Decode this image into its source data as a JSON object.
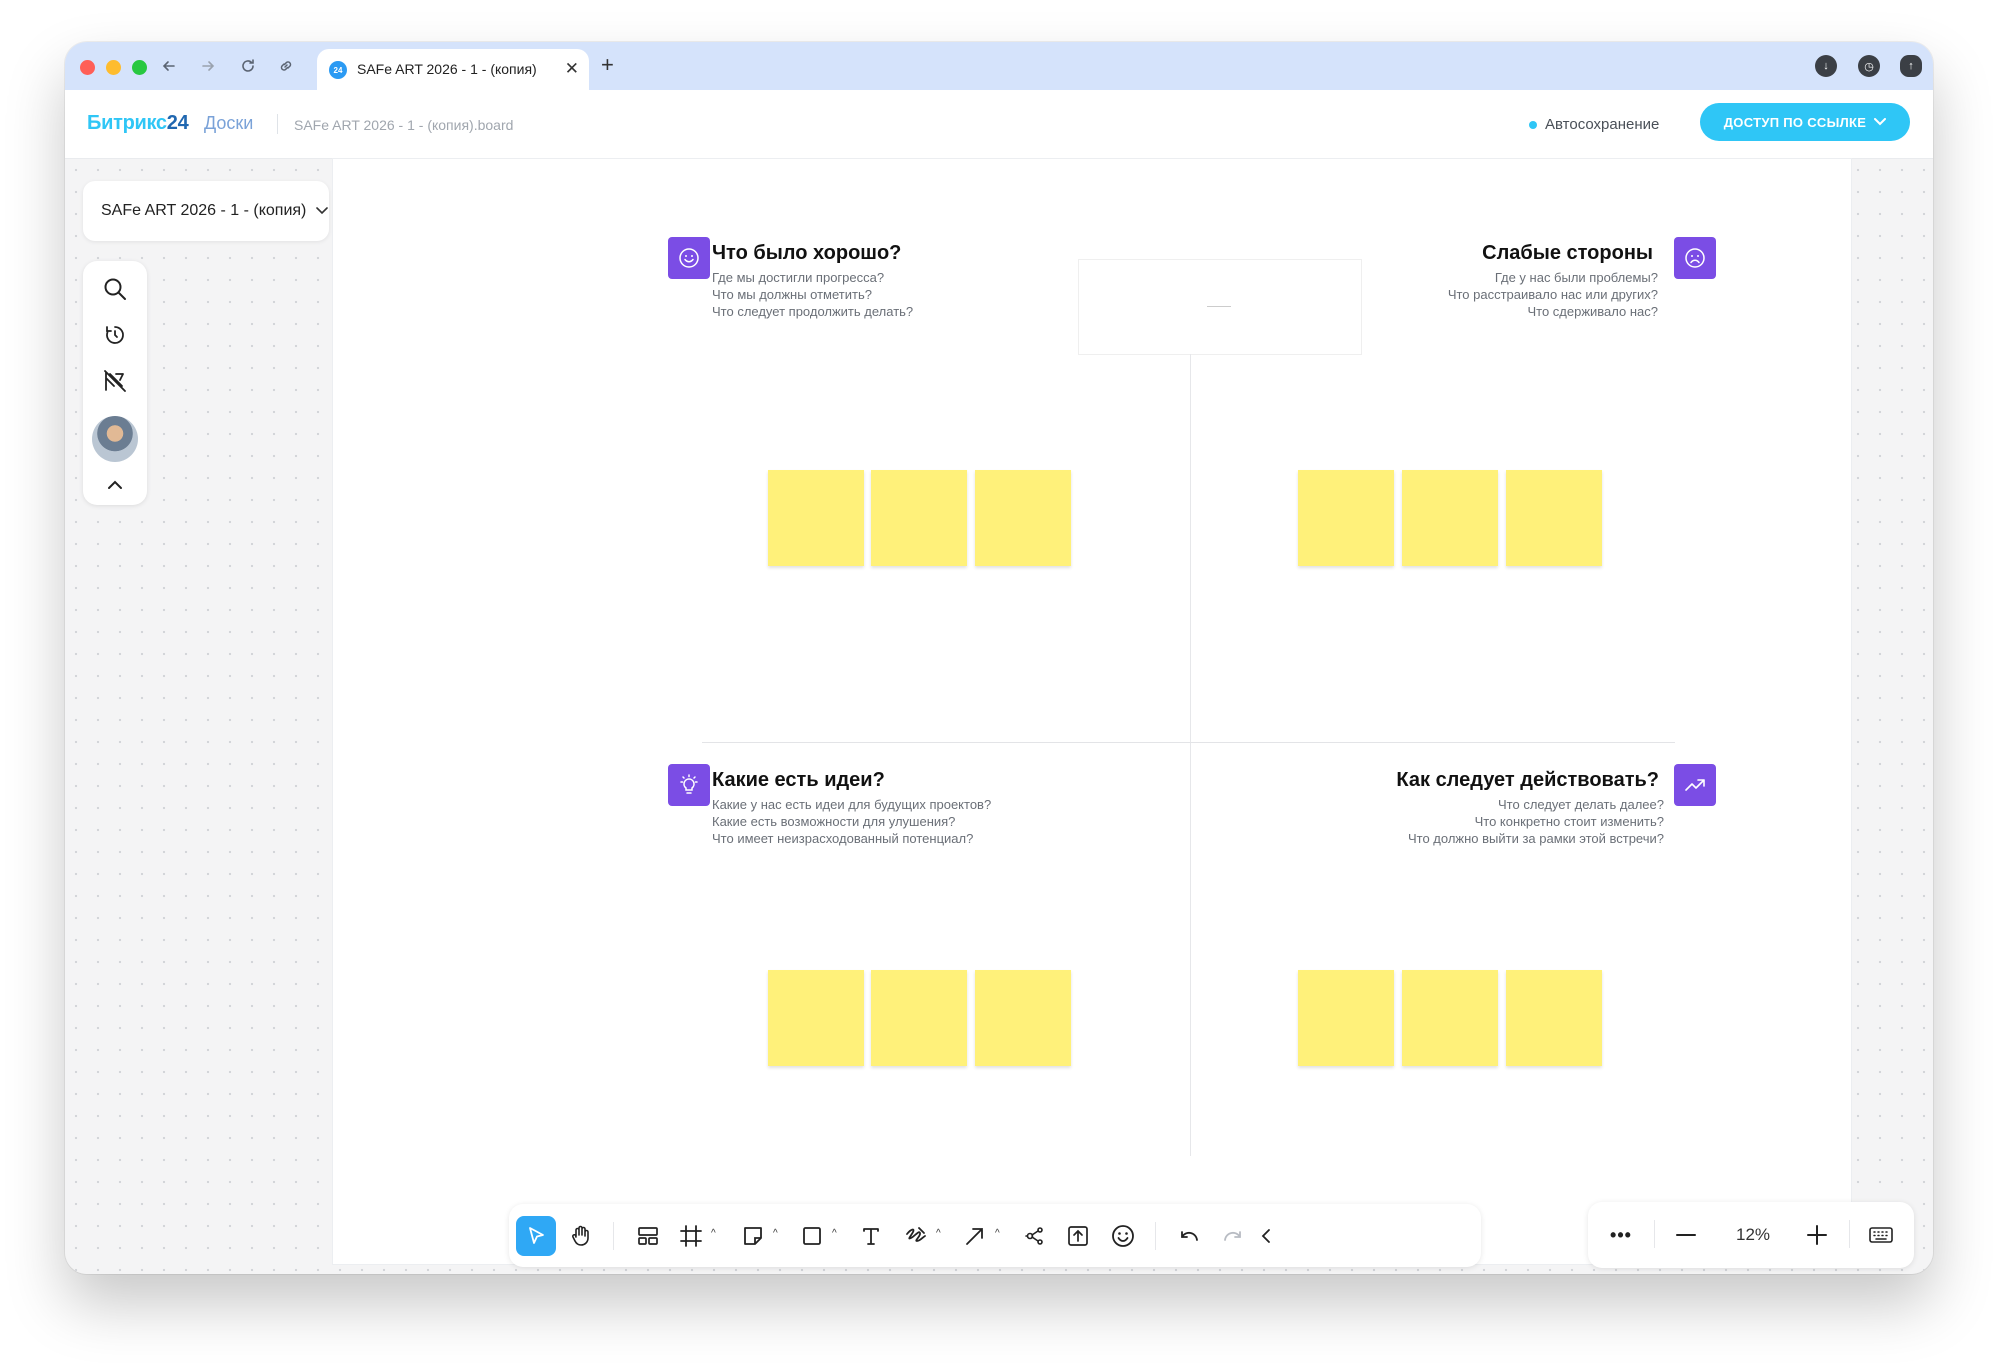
{
  "browser": {
    "tab_title": "SAFe ART 2026 - 1 - (копия)",
    "tab_favicon": "24",
    "new_tab": "+",
    "close_tab": "✕"
  },
  "header": {
    "logo_brand": "Битрикс",
    "logo_number": "24",
    "logo_product": "Доски",
    "file_name": "SAFe ART 2026 - 1 - (копия).board",
    "autosave": "Автосохранение",
    "access_button": "ДОСТУП ПО ССЫЛКЕ",
    "accent_color": "#2fc6f6"
  },
  "board": {
    "name": "SAFe ART 2026 - 1 - (копия)",
    "quadrants": [
      {
        "title": "Что было хорошо?",
        "icon": "smile-icon",
        "questions": [
          "Где мы достигли прогресса?",
          "Что мы должны отметить?",
          "Что следует продолжить делать?"
        ]
      },
      {
        "title": "Слабые стороны",
        "icon": "sad-face-icon",
        "questions": [
          "Где у нас были проблемы?",
          "Что расстраивало нас или других?",
          "Что сдерживало нас?"
        ]
      },
      {
        "title": "Какие есть идеи?",
        "icon": "lightbulb-icon",
        "questions": [
          "Какие у нас есть идеи для будущих проектов?",
          "Какие есть возможности для улушения?",
          "Что имеет неизрасходованный потенциал?"
        ]
      },
      {
        "title": "Как следует действовать?",
        "icon": "trend-up-icon",
        "questions": [
          "Что следует делать далее?",
          "Что конкретно стоит изменить?",
          "Что должно выйти за рамки этой встречи?"
        ]
      }
    ],
    "sticky_color": "#fff17a",
    "icon_color": "#7b4de5"
  },
  "left_tools": [
    "search-icon",
    "timer-icon",
    "no-draw-icon",
    "avatar",
    "collapse-icon"
  ],
  "toolbar": {
    "tools": [
      "select-tool",
      "hand-tool",
      "layout-tool",
      "frame-tool",
      "sticky-tool",
      "shape-tool",
      "text-tool",
      "pen-tool",
      "arrow-tool",
      "mindmap-tool",
      "upload-tool",
      "emoji-tool",
      "undo",
      "redo",
      "collapse"
    ]
  },
  "zoom": {
    "value": "12%",
    "more": "•••"
  }
}
